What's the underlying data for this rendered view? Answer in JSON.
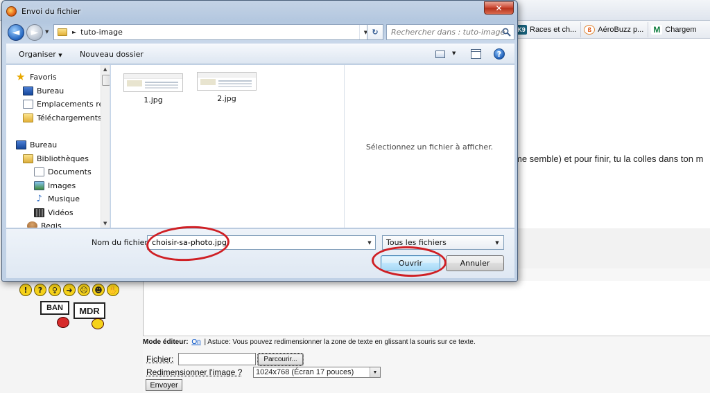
{
  "background": {
    "bookmarks": [
      {
        "icon": "k9-icon",
        "label": "Races et ch..."
      },
      {
        "icon": "aerobuzz-icon",
        "label": "AéroBuzz p..."
      },
      {
        "icon": "chargem-icon",
        "label": "Chargem"
      }
    ],
    "body_text": "me semble) et pour finir, tu la colles dans ton m",
    "smileys": [
      "!",
      "?",
      "♀",
      "➜",
      "☹",
      "☻",
      "✋"
    ],
    "sign_ban": "BAN",
    "sign_mdr": "MDR",
    "editor": {
      "mode_label": "Mode éditeur:",
      "mode_link": "On",
      "hint": "| Astuce: Vous pouvez redimensionner la zone de texte en glissant la souris sur ce texte."
    },
    "upload": {
      "file_label": "Fichier:",
      "file_value": "",
      "browse_label": "Parcourir...",
      "resize_label": "Redimensionner l'image ?",
      "resize_value": "1024x768 (Écran 17 pouces)",
      "send_label": "Envoyer"
    }
  },
  "dialog": {
    "title": "Envoi du fichier",
    "close_label": "✕",
    "address": {
      "path": "tuto-image"
    },
    "search_placeholder": "Rechercher dans : tuto-image",
    "toolbar": {
      "organize": "Organiser",
      "new_folder": "Nouveau dossier",
      "help": "?"
    },
    "nav": [
      {
        "icon": "star",
        "label": "Favoris",
        "indent": 0
      },
      {
        "icon": "desktop",
        "label": "Bureau",
        "indent": 1
      },
      {
        "icon": "places",
        "label": "Emplacements ré",
        "indent": 1
      },
      {
        "icon": "dl",
        "label": "Téléchargements",
        "indent": 1
      },
      {
        "icon": "desktop",
        "label": "Bureau",
        "indent": 0
      },
      {
        "icon": "lib",
        "label": "Bibliothèques",
        "indent": 1
      },
      {
        "icon": "doc",
        "label": "Documents",
        "indent": 2
      },
      {
        "icon": "img",
        "label": "Images",
        "indent": 2
      },
      {
        "icon": "mus",
        "label": "Musique",
        "indent": 2
      },
      {
        "icon": "vid",
        "label": "Vidéos",
        "indent": 2
      },
      {
        "icon": "user",
        "label": "Regis",
        "indent": 1
      }
    ],
    "files": [
      {
        "name": "1.jpg"
      },
      {
        "name": "2.jpg"
      }
    ],
    "preview_text": "Sélectionnez un fichier à afficher.",
    "filename_label": "Nom du fichier :",
    "filename_value": "choisir-sa-photo.jpg",
    "filetype_value": "Tous les fichiers",
    "open_label": "Ouvrir",
    "cancel_label": "Annuler"
  },
  "colors": {
    "annotation_red": "#cf1f24",
    "dialog_frame": "#b3c7df",
    "open_button": "#bee6fd"
  }
}
